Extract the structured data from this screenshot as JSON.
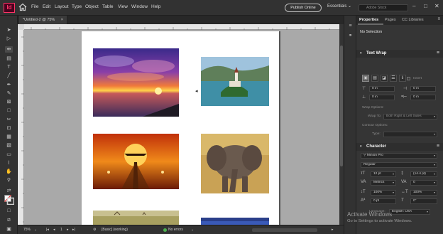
{
  "app": {
    "logo": "Id"
  },
  "menu": [
    "File",
    "Edit",
    "Layout",
    "Type",
    "Object",
    "Table",
    "View",
    "Window",
    "Help"
  ],
  "publish_label": "Publish Online",
  "workspace_label": "Essentials",
  "search_placeholder": "Adobe Stock",
  "window_controls": {
    "minimize": "–",
    "maximize": "□",
    "close": "✕"
  },
  "document_tab": "*Untitled-2 @ 75%",
  "status": {
    "zoom": "75%",
    "page_number": "1",
    "preflight_profile": "[Basic] (working)",
    "errors": "No errors"
  },
  "panel": {
    "tabs": [
      "Properties",
      "Pages",
      "CC Libraries"
    ],
    "selection": "No Selection",
    "text_wrap": {
      "title": "Text Wrap",
      "invert_label": "Invert",
      "offsets": {
        "top": "0 in",
        "bottom": "0 in",
        "left": "0 in",
        "right": "0 in"
      },
      "wrap_options_label": "Wrap Options:",
      "wrap_to_label": "Wrap To:",
      "wrap_to_value": "Both Right & Left Sides",
      "contour_options_label": "Contour Options:",
      "type_label": "Type:",
      "include_edges_label": "Include Inside Edges"
    },
    "character": {
      "title": "Character",
      "font_family": "Minion Pro",
      "font_style": "Regular",
      "font_size": "12 pt",
      "leading": "(14.4 pt)",
      "kerning": "Metrics",
      "tracking": "0",
      "vertical_scale": "100%",
      "horizontal_scale": "100%",
      "baseline_shift": "0 pt",
      "skew": "0°",
      "language_label": "Language:",
      "language": "English: USA"
    }
  },
  "watermark": {
    "title": "Activate Windows",
    "subtitle": "Go to Settings to activate Windows."
  },
  "colors": {
    "accent": "#ff3366",
    "panel_bg": "#353535",
    "chrome_bg": "#323232",
    "pasteboard": "#a9a9a9"
  },
  "icons": [
    "home-icon",
    "selection-tool-icon",
    "direct-selection-icon",
    "gap-tool-icon",
    "type-tool-icon",
    "pen-tool-icon",
    "rectangle-frame-icon",
    "scissors-icon",
    "hand-tool-icon",
    "zoom-tool-icon",
    "fill-stroke-icon"
  ]
}
